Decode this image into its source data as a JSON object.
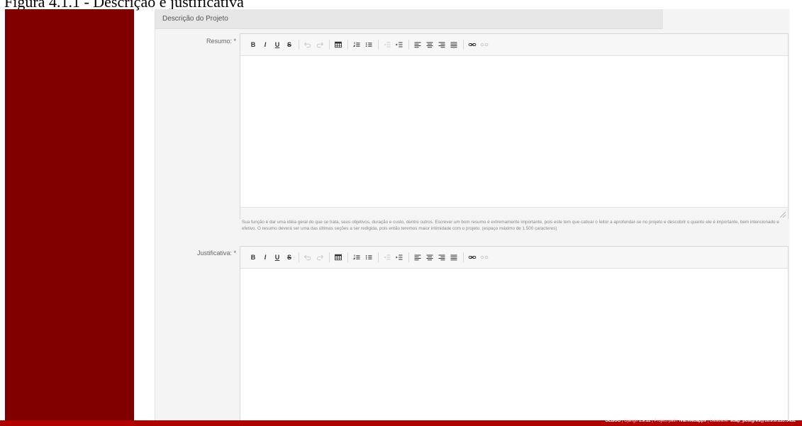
{
  "caption": "Figura 4.1.1 - Descrição e justificativa",
  "section": {
    "title": "Descrição do Projeto"
  },
  "colors": {
    "sidebar": "#800000",
    "footer": "#b00000"
  },
  "toolbar_icons": [
    "bold-icon",
    "italic-icon",
    "underline-icon",
    "strikethrough-icon",
    "undo-icon",
    "redo-icon",
    "table-icon",
    "ordered-list-icon",
    "unordered-list-icon",
    "outdent-icon",
    "indent-icon",
    "align-left-icon",
    "align-center-icon",
    "align-right-icon",
    "align-justify-icon",
    "link-icon",
    "unlink-icon"
  ],
  "toolbar_glyphs": {
    "bold": "B",
    "italic": "I",
    "underline": "U",
    "strike": "S"
  },
  "fields": {
    "resumo": {
      "label": "Resumo: *",
      "value": "",
      "help": "Sua função é dar uma idéia geral do que se trata, seus objetivos, duração e custo, dentre outros. Escrever um bom resumo é extremamente importante, pois este tem que cativar o leitor a aprofundar-se no projeto e descobrir o quanto ele é importante, bem intencionado e efetivo. O resumo deverá ser uma das últimas seções a ser redigida, pois então teremos maior intimidade com o projeto. (espaço máximo de 1.500 caracteres)"
    },
    "justificativa": {
      "label": "Justificativa: *",
      "value": ""
    }
  },
  "footer": {
    "debug": "DEBUG",
    "django_prefix": " | Django ",
    "django_version": "1.9.12",
    "project_prefix": " | Project path: ",
    "project_path": "/var/webapps",
    "database_prefix": " | Database: ",
    "database": "suap_postgres@10.0.0.135:5432"
  }
}
